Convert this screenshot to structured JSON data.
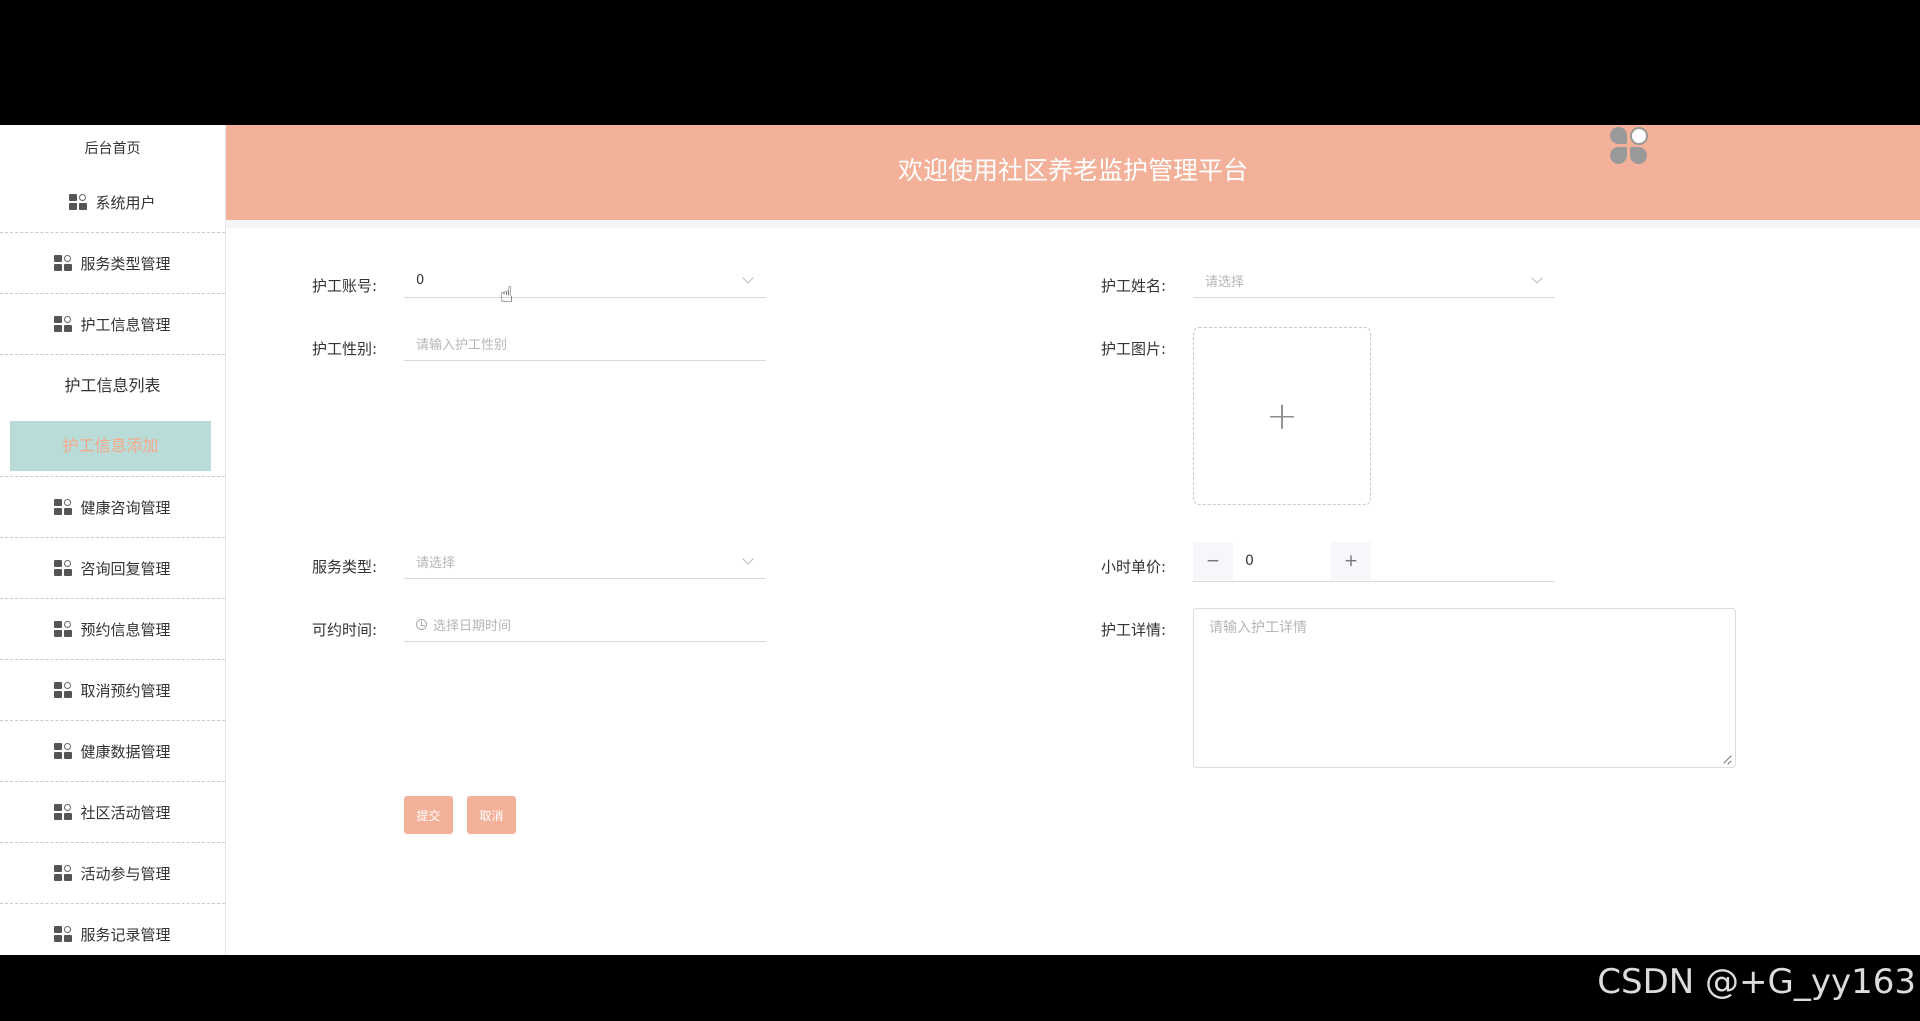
{
  "sidebar": {
    "home": "后台首页",
    "items_top": [
      "系统用户",
      "服务类型管理",
      "护工信息管理"
    ],
    "submenu": [
      "护工信息列表",
      "护工信息添加"
    ],
    "items_bottom": [
      "健康咨询管理",
      "咨询回复管理",
      "预约信息管理",
      "取消预约管理",
      "健康数据管理",
      "社区活动管理",
      "活动参与管理",
      "服务记录管理"
    ]
  },
  "header": {
    "title": "欢迎使用社区养老监护管理平台"
  },
  "form": {
    "account_label": "护工账号:",
    "account_value": "0",
    "name_label": "护工姓名:",
    "name_placeholder": "请选择",
    "gender_label": "护工性别:",
    "gender_placeholder": "请输入护工性别",
    "photo_label": "护工图片:",
    "photo_plus": "+",
    "service_label": "服务类型:",
    "service_placeholder": "请选择",
    "price_label": "小时单价:",
    "price_value": "0",
    "price_minus": "−",
    "price_plus": "+",
    "time_label": "可约时间:",
    "time_placeholder": "选择日期时间",
    "detail_label": "护工详情:",
    "detail_placeholder": "请输入护工详情",
    "submit": "提交",
    "cancel": "取消"
  },
  "watermark": "CSDN @+G_yy163",
  "colors": {
    "header": "#f4b199",
    "active_menu_bg": "#b9dcd9",
    "active_menu_text": "#f5a989",
    "button": "#f4b199"
  }
}
